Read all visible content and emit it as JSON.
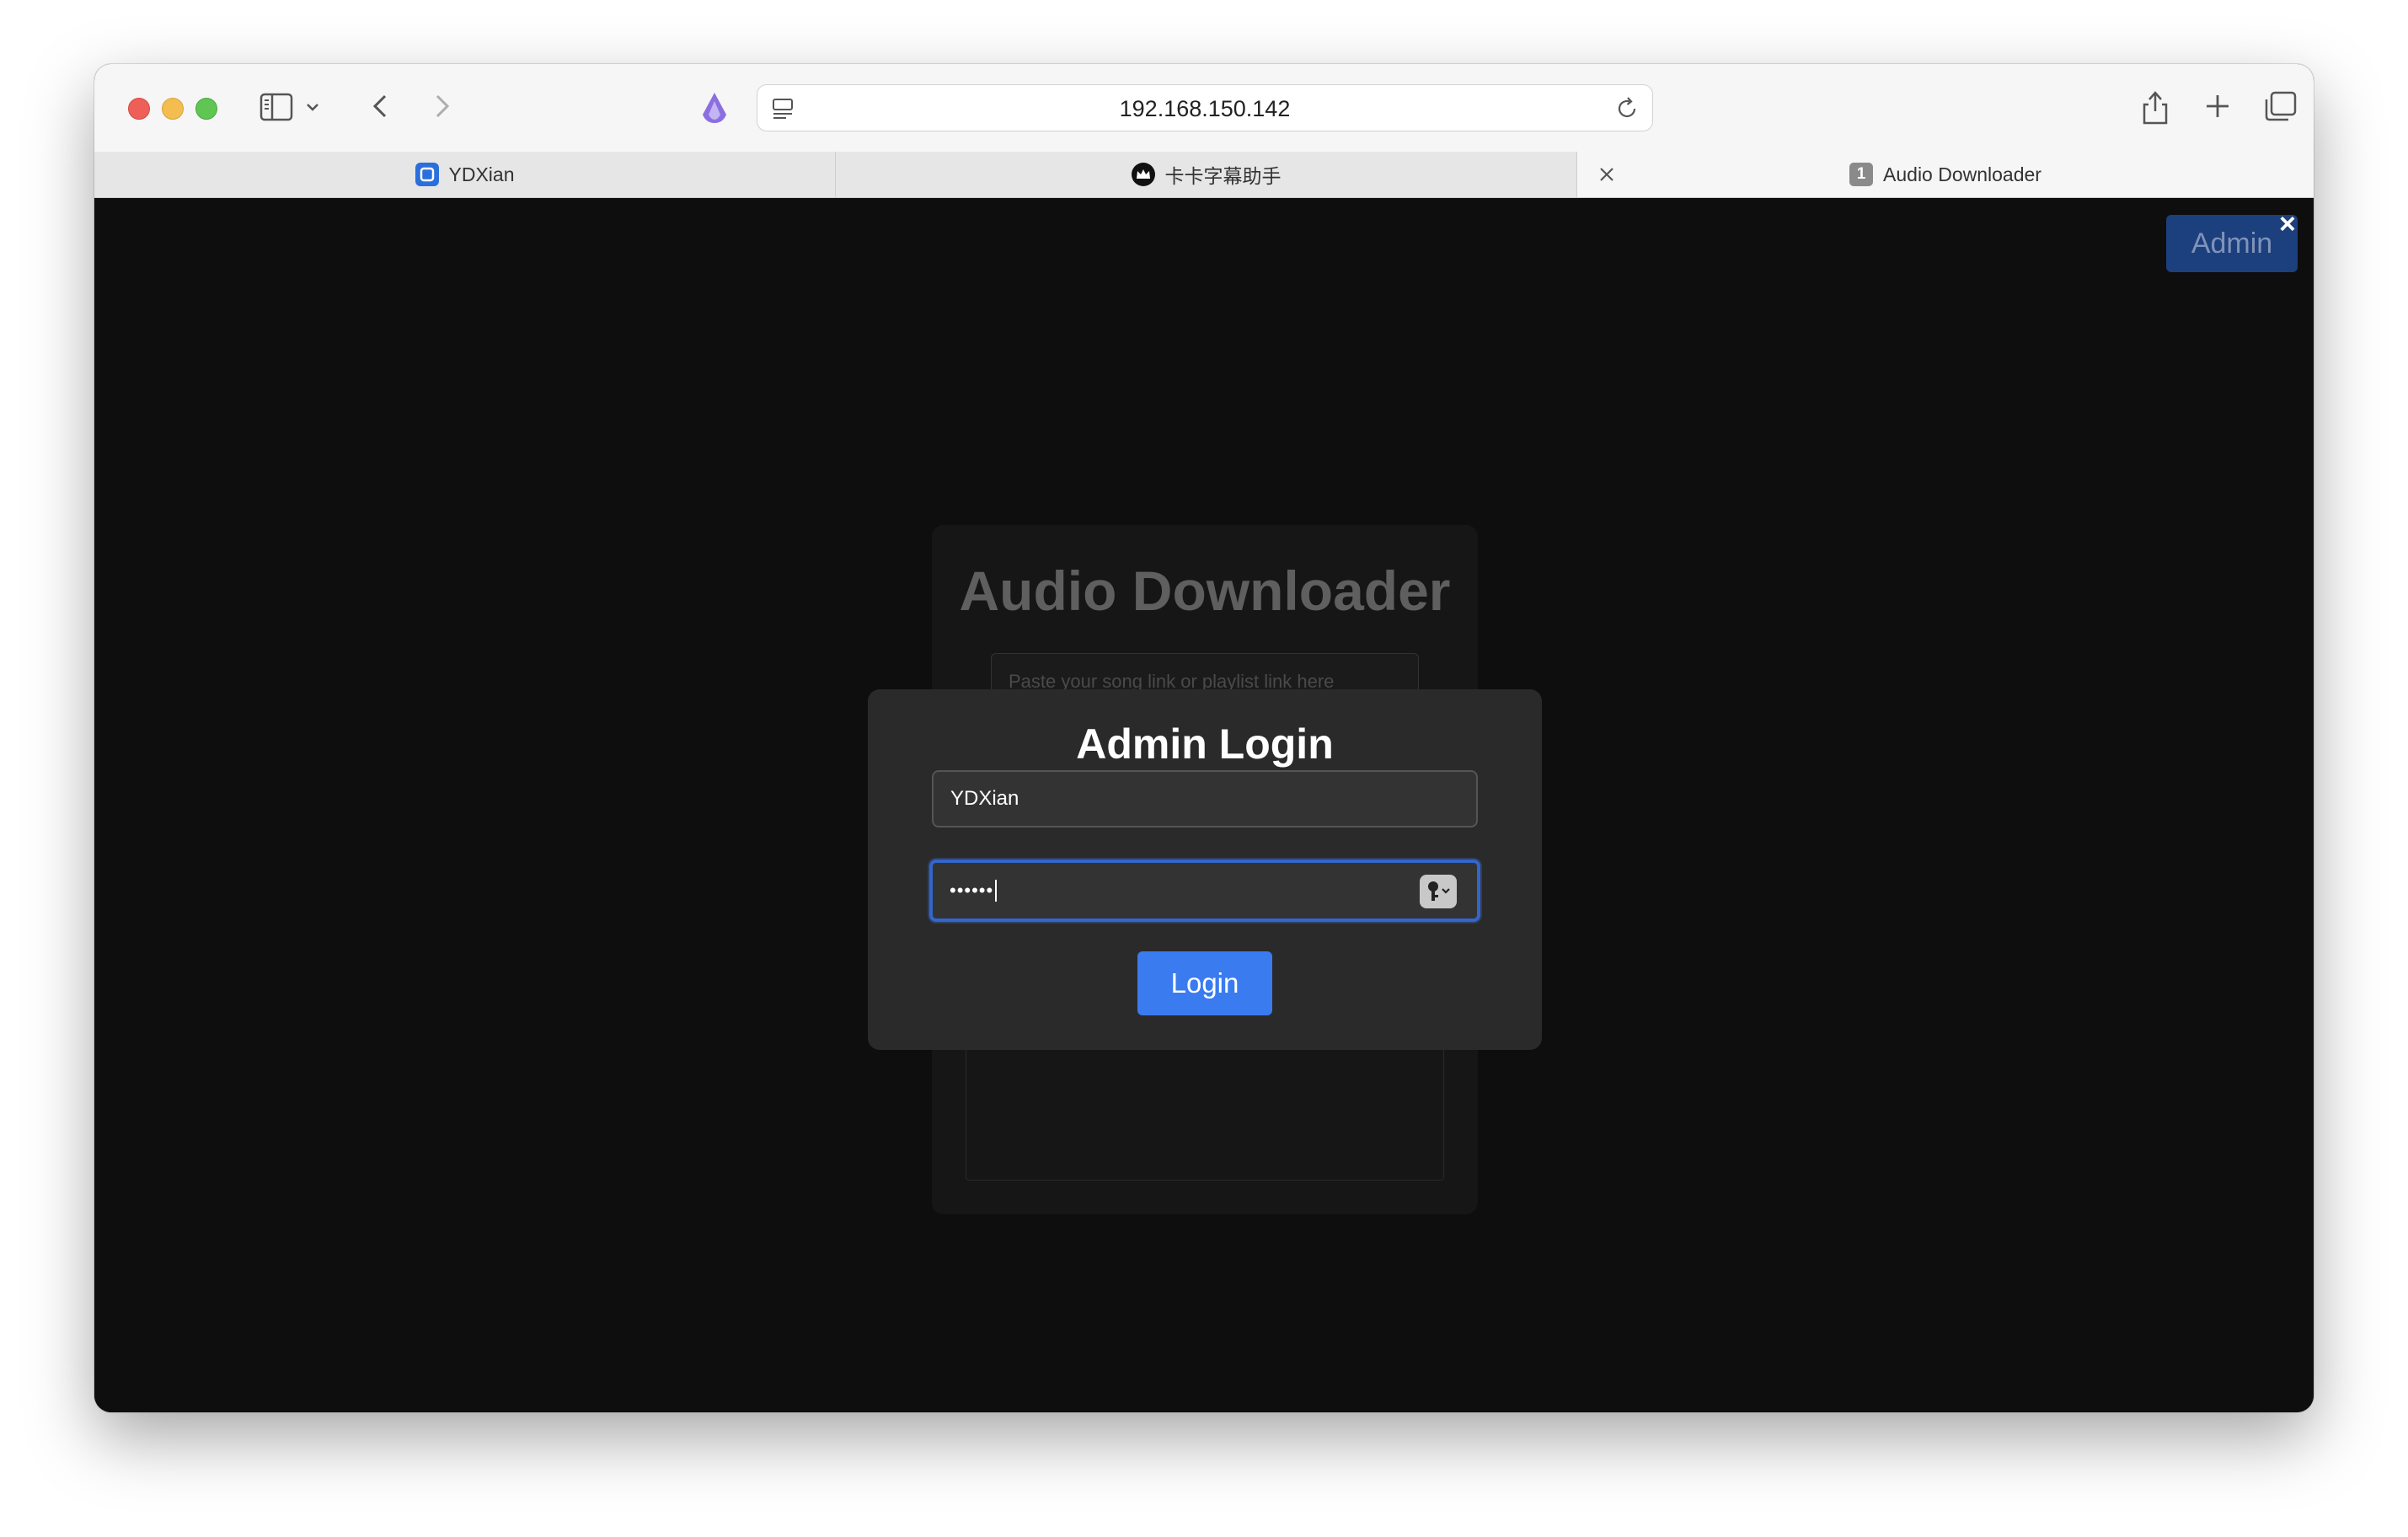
{
  "browser": {
    "url": "192.168.150.142",
    "tabs": [
      {
        "label": "YDXian",
        "favicon": "ydxian-app-icon"
      },
      {
        "label": "卡卡字幕助手",
        "favicon": "crown-icon"
      },
      {
        "label": "Audio Downloader",
        "favicon": "number-badge-icon",
        "badge": "1"
      }
    ]
  },
  "page": {
    "admin_button_label": "Admin",
    "admin_close_glyph": "×",
    "background_title": "Audio Downloader",
    "link_input_placeholder": "Paste your song link or playlist link here"
  },
  "login_modal": {
    "title": "Admin Login",
    "username_value": "YDXian",
    "password_masked": "••••••",
    "login_button_label": "Login"
  },
  "colors": {
    "page_background": "#0e0e0e",
    "modal_background": "#2a2a2a",
    "accent": "#3a7bf0",
    "focus_ring": "#3466c9"
  }
}
